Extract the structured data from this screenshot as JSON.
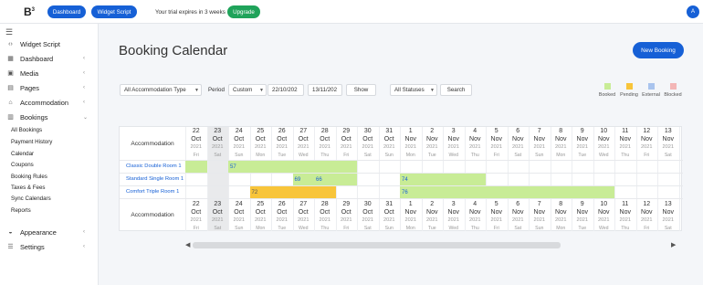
{
  "topbar": {
    "logo": "B",
    "dashboard_label": "Dashboard",
    "widget_label": "Widget Script",
    "trial_text": "Your trial expires in 3 weeks",
    "upgrade_label": "Upgrade",
    "avatar_initial": "A"
  },
  "sidebar": {
    "items": [
      {
        "label": "Widget Script",
        "icon": "code-icon"
      },
      {
        "label": "Dashboard",
        "icon": "dashboard-icon"
      },
      {
        "label": "Media",
        "icon": "image-icon"
      },
      {
        "label": "Pages",
        "icon": "page-icon"
      },
      {
        "label": "Accommodation",
        "icon": "home-icon"
      },
      {
        "label": "Bookings",
        "icon": "calendar-icon"
      }
    ],
    "sub_items": [
      "All Bookings",
      "Payment History",
      "Calendar",
      "Coupons",
      "Booking Rules",
      "Taxes & Fees",
      "Sync Calendars",
      "Reports"
    ],
    "bottom_items": [
      {
        "label": "Appearance",
        "icon": "paint-icon"
      },
      {
        "label": "Settings",
        "icon": "settings-icon"
      }
    ]
  },
  "main": {
    "title": "Booking Calendar",
    "new_booking_label": "New Booking",
    "filters": {
      "accommodation": "All Accommodation Type",
      "period_label": "Period",
      "period_value": "Custom",
      "date_from": "22/10/202",
      "date_to": "13/11/202",
      "show_label": "Show",
      "status": "All Statuses",
      "search_label": "Search"
    },
    "legend": [
      {
        "label": "Booked",
        "color": "#c8ec96"
      },
      {
        "label": "Pending",
        "color": "#f8c53a"
      },
      {
        "label": "External",
        "color": "#a9c4ee"
      },
      {
        "label": "Blocked",
        "color": "#f3b6b6"
      }
    ]
  },
  "calendar": {
    "header_label": "Accommodation",
    "footer_label": "Accommodation",
    "days": [
      {
        "d": "22",
        "m": "Oct",
        "y": "2021",
        "w": "Fri"
      },
      {
        "d": "23",
        "m": "Oct",
        "y": "2021",
        "w": "Sat"
      },
      {
        "d": "24",
        "m": "Oct",
        "y": "2021",
        "w": "Sun"
      },
      {
        "d": "25",
        "m": "Oct",
        "y": "2021",
        "w": "Mon"
      },
      {
        "d": "26",
        "m": "Oct",
        "y": "2021",
        "w": "Tue"
      },
      {
        "d": "27",
        "m": "Oct",
        "y": "2021",
        "w": "Wed"
      },
      {
        "d": "28",
        "m": "Oct",
        "y": "2021",
        "w": "Thu"
      },
      {
        "d": "29",
        "m": "Oct",
        "y": "2021",
        "w": "Fri"
      },
      {
        "d": "30",
        "m": "Oct",
        "y": "2021",
        "w": "Sat"
      },
      {
        "d": "31",
        "m": "Oct",
        "y": "2021",
        "w": "Sun"
      },
      {
        "d": "1",
        "m": "Nov",
        "y": "2021",
        "w": "Mon"
      },
      {
        "d": "2",
        "m": "Nov",
        "y": "2021",
        "w": "Tue"
      },
      {
        "d": "3",
        "m": "Nov",
        "y": "2021",
        "w": "Wed"
      },
      {
        "d": "4",
        "m": "Nov",
        "y": "2021",
        "w": "Thu"
      },
      {
        "d": "5",
        "m": "Nov",
        "y": "2021",
        "w": "Fri"
      },
      {
        "d": "6",
        "m": "Nov",
        "y": "2021",
        "w": "Sat"
      },
      {
        "d": "7",
        "m": "Nov",
        "y": "2021",
        "w": "Sun"
      },
      {
        "d": "8",
        "m": "Nov",
        "y": "2021",
        "w": "Mon"
      },
      {
        "d": "9",
        "m": "Nov",
        "y": "2021",
        "w": "Tue"
      },
      {
        "d": "10",
        "m": "Nov",
        "y": "2021",
        "w": "Wed"
      },
      {
        "d": "11",
        "m": "Nov",
        "y": "2021",
        "w": "Thu"
      },
      {
        "d": "12",
        "m": "Nov",
        "y": "2021",
        "w": "Fri"
      },
      {
        "d": "13",
        "m": "Nov",
        "y": "2021",
        "w": "Sat"
      }
    ],
    "today_index": 1,
    "rooms": [
      "Classic Double Room 1",
      "Standard Single Room 1",
      "Comfort Triple Room 1"
    ],
    "bookings": [
      {
        "room": 0,
        "start": 0,
        "end": 1,
        "status": "booked",
        "label": ""
      },
      {
        "room": 0,
        "start": 2,
        "end": 8,
        "status": "booked",
        "label": "57"
      },
      {
        "room": 1,
        "start": 5,
        "end": 6,
        "status": "booked",
        "label": "69"
      },
      {
        "room": 1,
        "start": 6,
        "end": 8,
        "status": "booked",
        "label": "66"
      },
      {
        "room": 1,
        "start": 10,
        "end": 14,
        "status": "booked",
        "label": "74"
      },
      {
        "room": 2,
        "start": 3,
        "end": 7,
        "status": "pending",
        "label": "72"
      },
      {
        "room": 2,
        "start": 10,
        "end": 20,
        "status": "booked",
        "label": "76"
      }
    ]
  }
}
